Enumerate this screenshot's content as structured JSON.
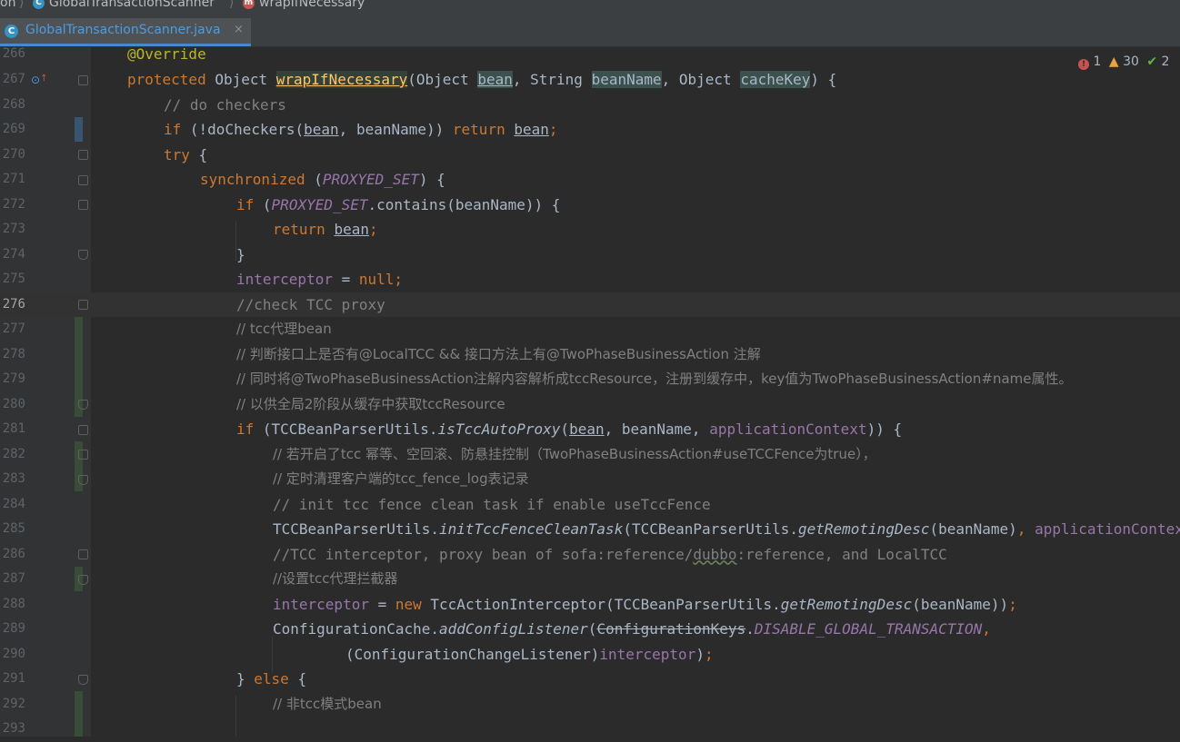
{
  "breadcrumb": {
    "items": [
      {
        "label": "on",
        "icon": ""
      },
      {
        "label": "GlobalTransactionScanner",
        "icon": "C"
      },
      {
        "label": "wrapIfNecessary",
        "icon": "m"
      }
    ]
  },
  "tab": {
    "title": "GlobalTransactionScanner.java",
    "icon": "C",
    "close": "×"
  },
  "inspections": {
    "errors": "1",
    "warnings": "30",
    "weak_warnings": "2"
  },
  "editor": {
    "current_line": 276,
    "lines": [
      {
        "n": "266",
        "t": "@Override"
      },
      {
        "n": "267",
        "t": "protected Object wrapIfNecessary(Object bean, String beanName, Object cacheKey) {"
      },
      {
        "n": "268",
        "t": "// do checkers"
      },
      {
        "n": "269",
        "t": "if (!doCheckers(bean, beanName)) return bean;"
      },
      {
        "n": "270",
        "t": "try {"
      },
      {
        "n": "271",
        "t": "synchronized (PROXYED_SET) {"
      },
      {
        "n": "272",
        "t": "if (PROXYED_SET.contains(beanName)) {"
      },
      {
        "n": "273",
        "t": "return bean;"
      },
      {
        "n": "274",
        "t": "}"
      },
      {
        "n": "275",
        "t": "interceptor = null;"
      },
      {
        "n": "276",
        "t": "//check TCC proxy"
      },
      {
        "n": "277",
        "t": "// tcc代理bean"
      },
      {
        "n": "278",
        "t": "// 判断接口上是否有@LocalTCC && 接口方法上有@TwoPhaseBusinessAction 注解"
      },
      {
        "n": "279",
        "t": "// 同时将@TwoPhaseBusinessAction注解内容解析成tccResource，注册到缓存中，key值为TwoPhaseBusinessAction#name属性。"
      },
      {
        "n": "280",
        "t": "// 以供全局2阶段从缓存中获取tccResource"
      },
      {
        "n": "281",
        "t": "if (TCCBeanParserUtils.isTccAutoProxy(bean, beanName, applicationContext)) {"
      },
      {
        "n": "282",
        "t": "// 若开启了tcc 幂等、空回滚、防悬挂控制（TwoPhaseBusinessAction#useTCCFence为true），"
      },
      {
        "n": "283",
        "t": "// 定时清理客户端的tcc_fence_log表记录"
      },
      {
        "n": "284",
        "t": "// init tcc fence clean task if enable useTccFence"
      },
      {
        "n": "285",
        "t": "TCCBeanParserUtils.initTccFenceCleanTask(TCCBeanParserUtils.getRemotingDesc(beanName), applicationContext);"
      },
      {
        "n": "286",
        "t": "//TCC interceptor, proxy bean of sofa:reference/dubbo:reference, and LocalTCC"
      },
      {
        "n": "287",
        "t": "//设置tcc代理拦截器"
      },
      {
        "n": "288",
        "t": "interceptor = new TccActionInterceptor(TCCBeanParserUtils.getRemotingDesc(beanName));"
      },
      {
        "n": "289",
        "t": "ConfigurationCache.addConfigListener(ConfigurationKeys.DISABLE_GLOBAL_TRANSACTION,"
      },
      {
        "n": "290",
        "t": "(ConfigurationChangeListener)interceptor);"
      },
      {
        "n": "291",
        "t": "} else {"
      },
      {
        "n": "292",
        "t": "// 非tcc模式bean"
      },
      {
        "n": "293",
        "t": ""
      }
    ]
  },
  "colors": {
    "background": "#2b2b2b",
    "gutter": "#313335",
    "keyword": "#cc7832",
    "comment": "#808080",
    "field": "#9876aa",
    "method": "#ffc66d",
    "annotation": "#bbb529",
    "text": "#a9b7c6",
    "tab_accent": "#4a88c7"
  }
}
